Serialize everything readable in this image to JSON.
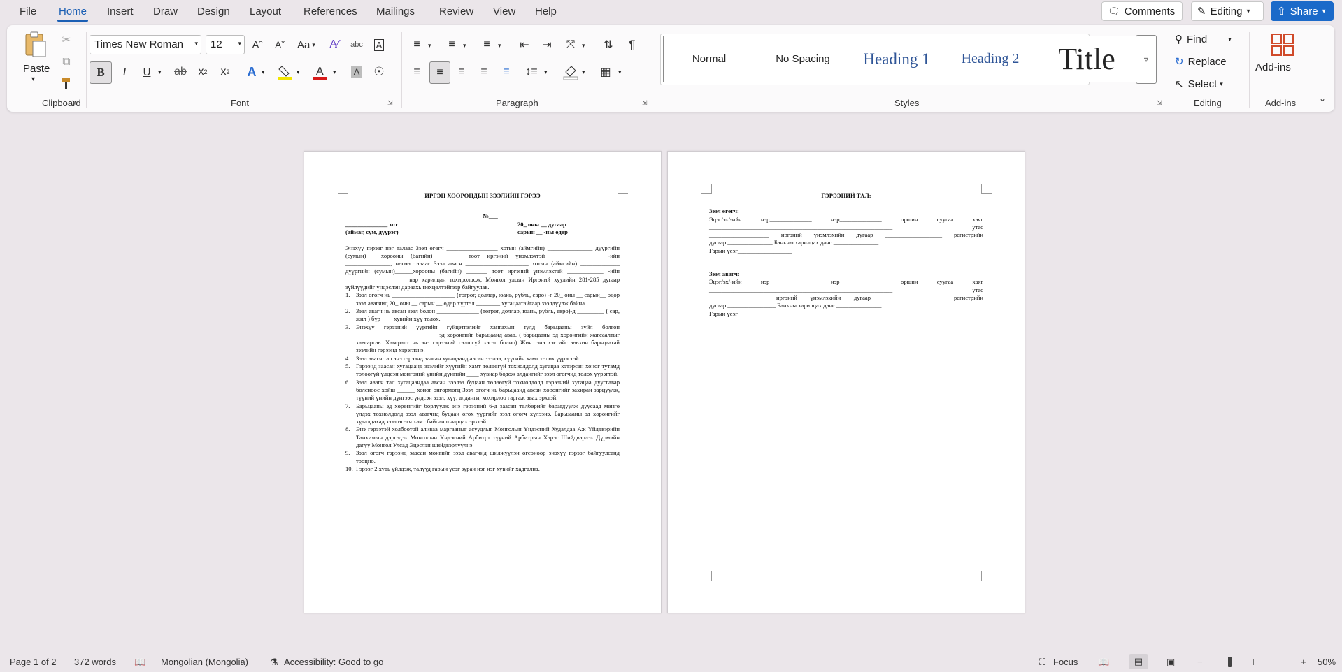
{
  "menu": [
    "File",
    "Home",
    "Insert",
    "Draw",
    "Design",
    "Layout",
    "References",
    "Mailings",
    "Review",
    "View",
    "Help"
  ],
  "topbar": {
    "comments": "Comments",
    "editing": "Editing",
    "share": "Share"
  },
  "clipboard": {
    "paste": "Paste",
    "label": "Clipboard"
  },
  "font": {
    "family": "Times New Roman",
    "size": "12",
    "label": "Font",
    "case": "Aa"
  },
  "paragraph": {
    "label": "Paragraph"
  },
  "styles": {
    "items": [
      "Normal",
      "No Spacing",
      "Heading 1",
      "Heading 2",
      "Title"
    ],
    "label": "Styles"
  },
  "editing": {
    "find": "Find",
    "replace": "Replace",
    "select": "Select",
    "label": "Editing"
  },
  "addins": {
    "button": "Add-ins",
    "label": "Add-ins"
  },
  "page1": {
    "title": "ИРГЭН ХООРОНДЫН ЗЭЭЛИЙН ГЭРЭЭ",
    "number": "№___",
    "city": "______________ хот",
    "city_sub": "(аймаг, сум, дүүрэг)",
    "date": "20_ оны __ дугаар",
    "date_sub": "сарын __ -ны  өдөр",
    "intro": "Энэхүү гэрээг нэг талаас Зээл өгөгч _________________ хотын (аймгийн) _______________ дүүргийн (сумын)_____хорооны (багийн) _______ тоот иргэний үнэмлэхтэй ________________ -ийн _______________, нөгөө талаас Зээл авагч _____________________ хотын (аймгийн) _____________ дүүргийн (сумын)______хорооны (багийн) _______ тоот иргэний үнэмлэхтэй ____________ -ийн ____________________ нар харилцан тохиролцож, Монгол улсын Иргэний хуулийн 281-285 дугаар зүйлүүдийг үндэслэн дараахь нөхцөлтэйгээр байгуулав.",
    "items": [
      "Зээл өгөгч нь _____________________ (төгрөг, доллар, юань, рубль, евро) -г 20_ оны __ сарын__ өдөр зээл авагчид 20_ оны __ сарын __ өдөр хүртэл ________ хугацаатайгаар зээлдүүлж байна.",
      "Зээл авагч нь авсан зээл болон ______________ (төгрөг, доллар, юань, рубль, евро)-д _________ ( сар, жил ) бүр ____хувийн хүү төлөх.",
      "Энэхүү гэрээний үүргийн гүйцэтгэлийг хангахын тулд барьцааны зүйл болгон ___________________________ эд хөрөнгийг барьцаанд авав. ( барьцааны эд хөрөнгийн жагсаалтыг хавсаргав. Хавсралт нь энэ гэрээний салшгүй хэсэг болно) Жич: энэ хэсгийг зөвхөн барьцаатай зээлийн гэрээнд хэрэглэнэ.",
      "Зээл авагч тал энэ гэрээнд заасан хугацаанд авсан зээлээ, хүүгийн хамт төлөх үүрэгтэй.",
      "Гэрээнд заасан хугацаанд зээлийг хүүгийн хамт төлөөгүй тохиолдолд хугацаа хэтэрсэн хоног тутамд төлөөгүй үлдсэн мөнгөний үнийн дүнгийн ____ хувиар бодож алдангийг зээл өгөгчид төлөх үүрэгтэй.",
      "Зээл авагч тал хугацаандаа авсан зээлээ буцаан төлөөгүй тохиолдолд гэрээний хугацаа дуусгавар болсноос хойш ______ хоног өнгөрмөгц Зээл өгөгч нь барьцаанд авсан хөрөнгийг захиран зарцуулж, түүний үнийн дүнгээс үндсэн зээл, хүү, алданги, хохирлоо гаргаж авах эрхтэй.",
      "Барьцааны эд хөрөнгийг борлуулж энэ гэрээний 6-д заасан төлбөрийг барагдуулж дуусаад мөнгө үлдэх тохиолдолд зээл авагчид буцаан өгөх үүргийг зээл өгөгч хүлээнэ. Барьцааны эд хөрөнгийг худалдахад зээл өгөгч хамт байсан шаардах эрхтэй.",
      "Энэ гэрээтэй холбоотой аливаа маргааныг асуудлыг Монголын Үндэсний Худалдаа Аж Үйлдвэрийн Танхимын дэргэдэх Монголын Үндэсний Арбитрт түүний Арбитрын Хэрэг Шийдвэрлэх Дүрмийн дагуу Монгол Улсад Эцэслэн шийдвэрлүүлнэ",
      "Зээл өгөгч гэрээнд заасан мөнгийг зээл авагчид шилжүүлэн өгсөнөөр энэхүү гэрээг байгуулсанд тооцно.",
      "Гэрээг 2 хувь үйлдэж, талууд гарын үсэг зуран нэг нэг хувийг хадгална."
    ]
  },
  "page2": {
    "title": "ГЭРЭЭНИЙ ТАЛ:",
    "lender_head": "Зээл өгөгч:",
    "lender_lines": [
      "Эцэг/эх/-ийн нэр______________ нэр______________ оршин суугаа хаяг",
      "_____________________________________________________________ утас",
      "____________________ иргэний үнэмлэхийн дугаар ___________________ регистрийн",
      "дугаар _______________ Банкны харилцах данс _______________",
      "Гарын үсэг__________________"
    ],
    "borrower_head": "Зээл авагч:",
    "borrower_lines": [
      "Эцэг/эх/-ийн нэр______________ нэр______________ оршин суугаа хаяг",
      "_____________________________________________________________ утас",
      "__________________ иргэний үнэмлэхийн дугаар ___________________ регистрийн",
      "дугаар ________________ Банкны харилцах данс _______________",
      "Гарын үсэг __________________"
    ]
  },
  "status": {
    "page": "Page 1 of 2",
    "words": "372 words",
    "language": "Mongolian (Mongolia)",
    "accessibility": "Accessibility: Good to go",
    "focus": "Focus",
    "zoom": "50%",
    "zoom_level": 0.5
  }
}
